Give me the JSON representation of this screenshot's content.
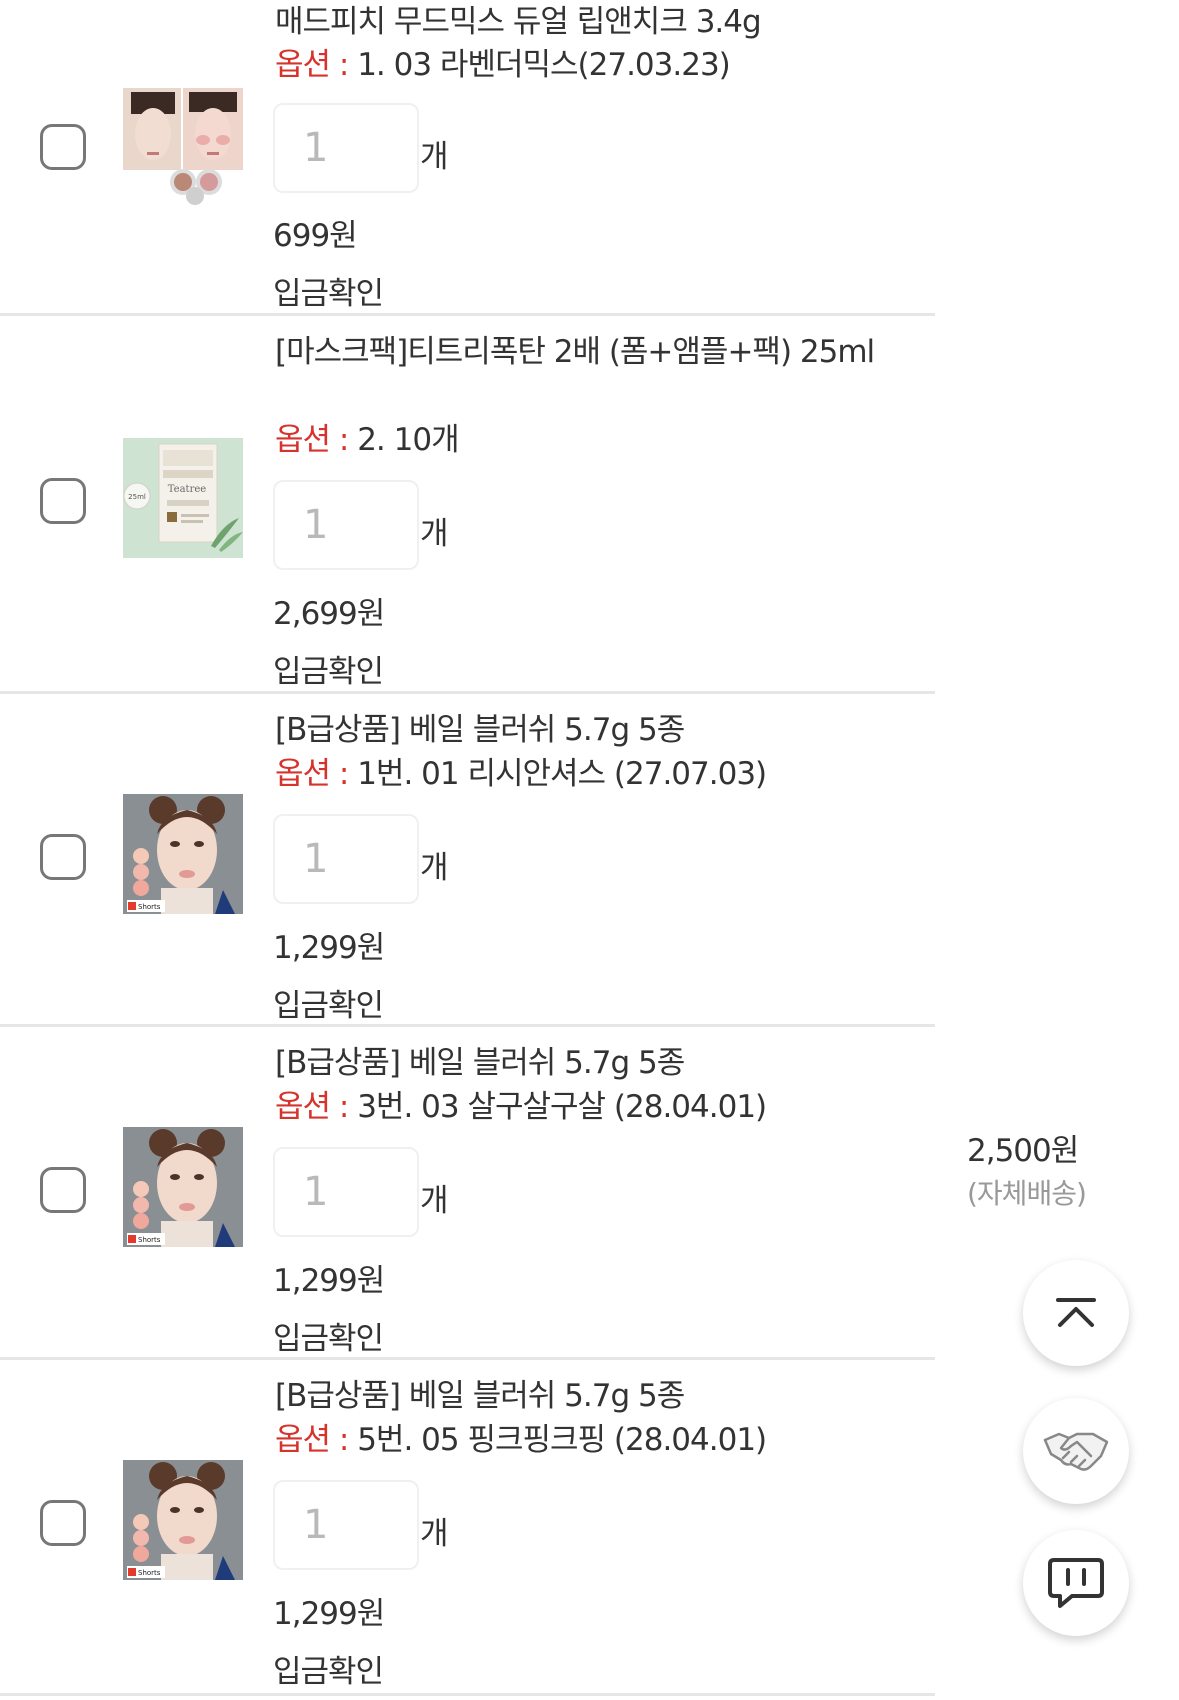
{
  "items": [
    {
      "title": "매드피치 무드믹스 듀얼 립앤치크 3.4g",
      "option_label": "옵션 :",
      "option_value": "1. 03 라벤더믹스(27.03.23)",
      "quantity": "1",
      "unit": "개",
      "price": "699원",
      "status": "입금확인"
    },
    {
      "title": "[마스크팩]티트리폭탄 2배 (폼+앰플+팩) 25ml",
      "option_label": "옵션 :",
      "option_value": "2. 10개",
      "quantity": "1",
      "unit": "개",
      "price": "2,699원",
      "status": "입금확인"
    },
    {
      "title": "[B급상품] 베일 블러쉬 5.7g 5종",
      "option_label": "옵션 :",
      "option_value": "1번. 01 리시안셔스 (27.07.03)",
      "quantity": "1",
      "unit": "개",
      "price": "1,299원",
      "status": "입금확인"
    },
    {
      "title": "[B급상품] 베일 블러쉬 5.7g 5종",
      "option_label": "옵션 :",
      "option_value": "3번. 03 살구살구살 (28.04.01)",
      "quantity": "1",
      "unit": "개",
      "price": "1,299원",
      "status": "입금확인"
    },
    {
      "title": "[B급상품] 베일 블러쉬 5.7g 5종",
      "option_label": "옵션 :",
      "option_value": "5번. 05 핑크핑크핑 (28.04.01)",
      "quantity": "1",
      "unit": "개",
      "price": "1,299원",
      "status": "입금확인"
    }
  ],
  "thumb_text": {
    "teatree_brand": "Teatree",
    "teatree_volume": "25ml",
    "shorts_badge": "Shorts"
  },
  "shipping": {
    "fee": "2,500원",
    "type": "(자체배송)"
  },
  "fab": {
    "top_icon": "scroll-top-icon",
    "handshake_icon": "handshake-icon",
    "chat_icon": "chat-icon"
  },
  "colors": {
    "option_label": "#d7332d",
    "divider": "#e6e6e6",
    "quantity_text": "#b9b9b9"
  }
}
